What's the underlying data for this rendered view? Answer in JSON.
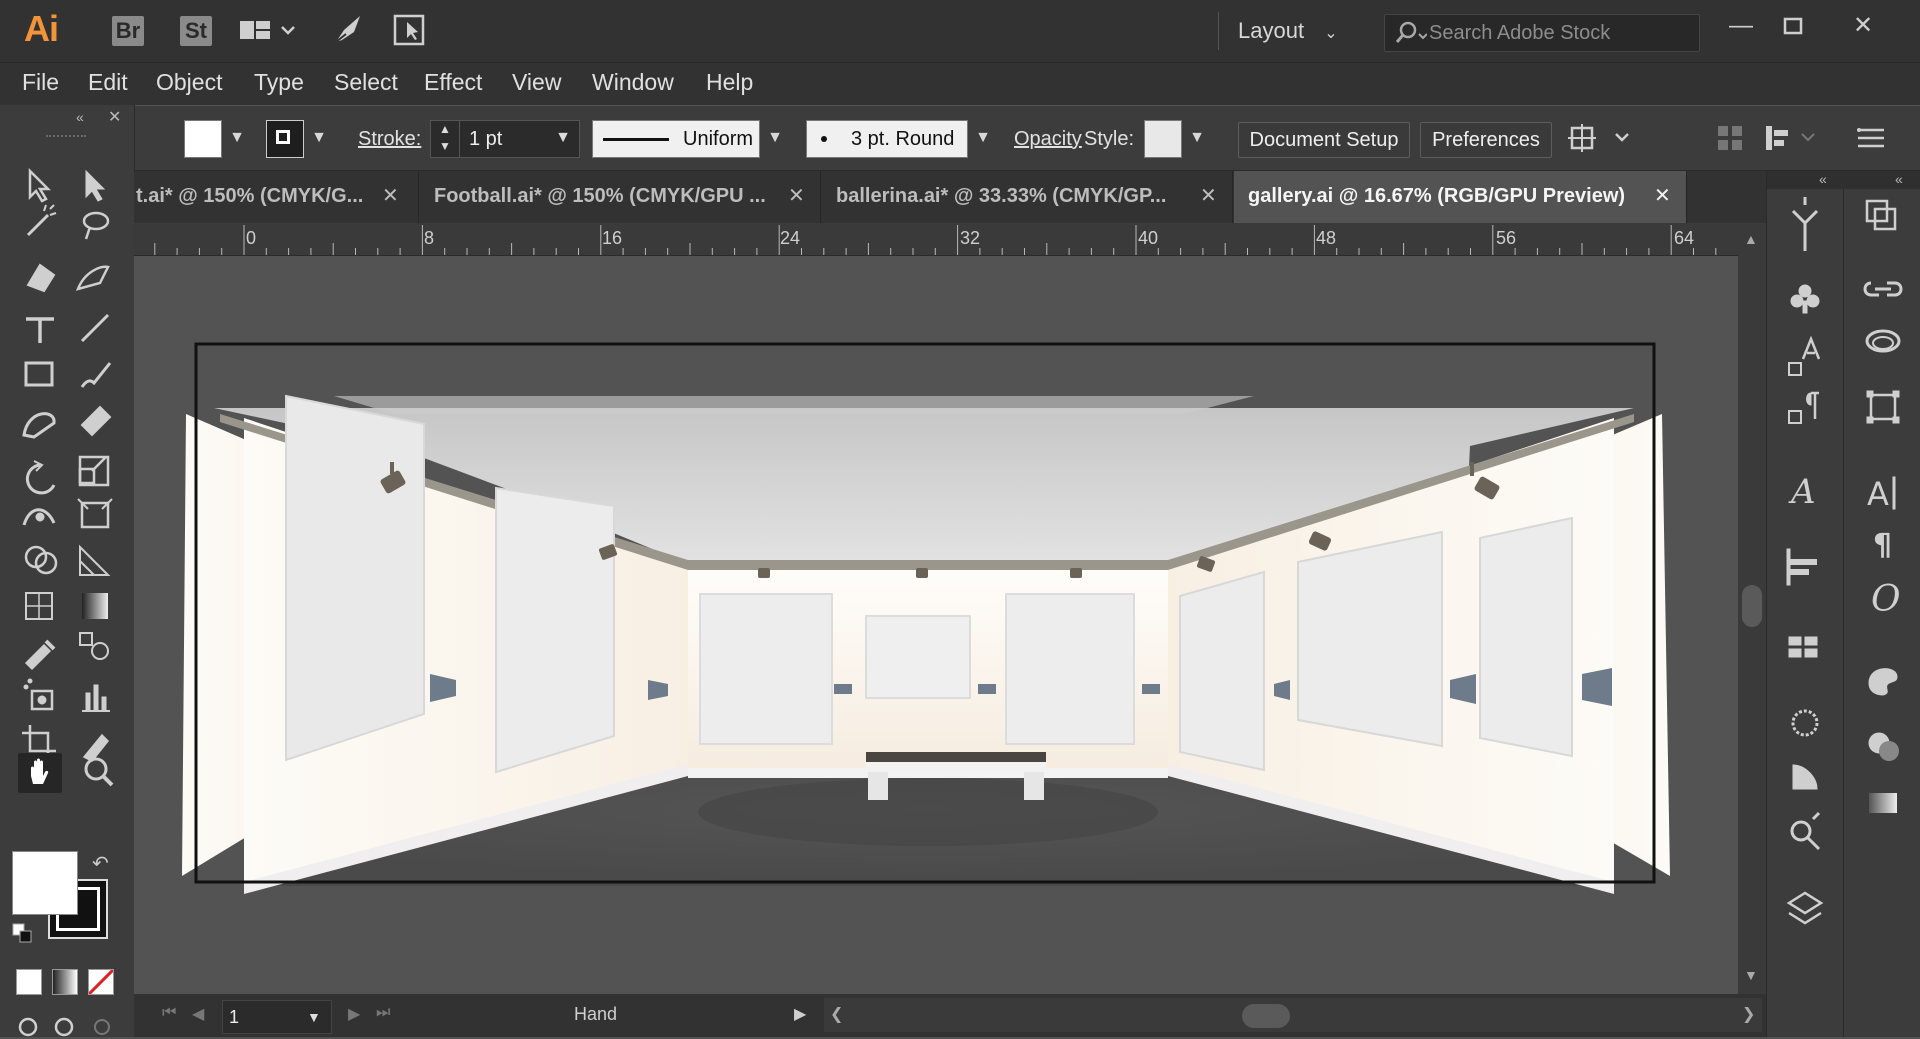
{
  "app": {
    "logo": "Ai",
    "bridge_badge": "Br",
    "stock_badge": "St",
    "workspace": "Layout",
    "search_placeholder": "Search Adobe Stock"
  },
  "menu": [
    "File",
    "Edit",
    "Object",
    "Type",
    "Select",
    "Effect",
    "View",
    "Window",
    "Help"
  ],
  "control": {
    "stroke_label": "Stroke:",
    "stroke_value": "1 pt",
    "profile": "Uniform",
    "brush": "3 pt. Round",
    "opacity_label": "Opacity",
    "style_label": "Style:",
    "document_setup": "Document Setup",
    "preferences": "Preferences"
  },
  "tabs": [
    {
      "label": "t.ai* @ 150% (CMYK/G...",
      "active": false
    },
    {
      "label": "Football.ai* @ 150% (CMYK/GPU ...",
      "active": false
    },
    {
      "label": "ballerina.ai* @ 33.33% (CMYK/GP...",
      "active": false
    },
    {
      "label": "gallery.ai @ 16.67% (RGB/GPU Preview)",
      "active": true
    }
  ],
  "ruler_labels": [
    "0",
    "8",
    "16",
    "24",
    "32",
    "40",
    "48",
    "56",
    "64"
  ],
  "status": {
    "artboard": "1",
    "tool": "Hand"
  },
  "colors": {
    "accent": "#f2953a",
    "ui_dark": "#323232",
    "ui_mid": "#3c3c3c",
    "canvas": "#535353"
  }
}
